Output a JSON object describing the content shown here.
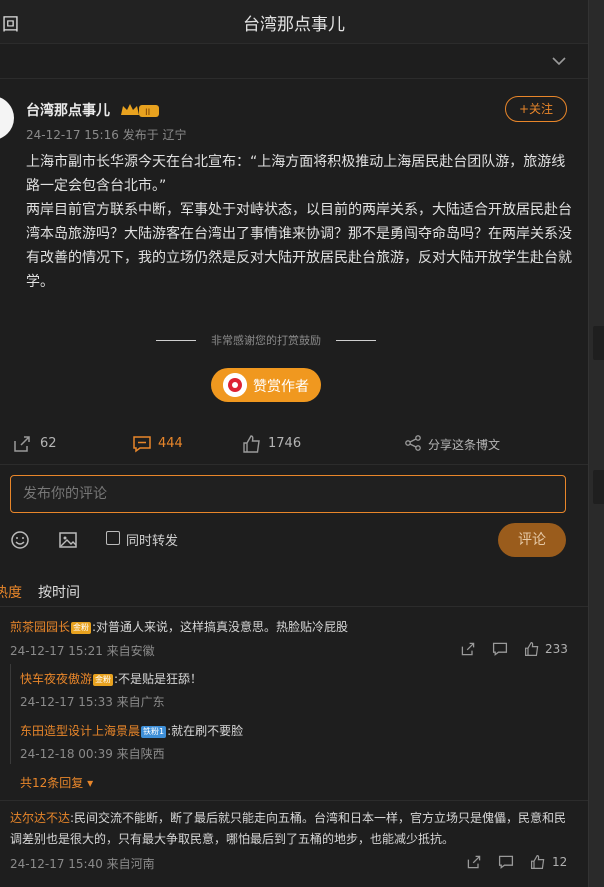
{
  "header": {
    "back_label": "回",
    "title": "台湾那点事儿"
  },
  "post": {
    "author": "台湾那点事儿",
    "vip_badge": "II",
    "time": "24-12-17 15:16",
    "source": "发布于 辽宁",
    "follow_label": "+关注",
    "paragraphs": [
      "上海市副市长华源今天在台北宣布：“上海方面将积极推动上海居民赴台团队游，旅游线路一定会包含台北市。”",
      "两岸目前官方联系中断，军事处于对峙状态，以目前的两岸关系，大陆适合开放居民赴台湾本岛旅游吗？大陆游客在台湾出了事情谁来协调？那不是勇闯夺命岛吗？在两岸关系没有改善的情况下，我的立场仍然是反对大陆开放居民赴台旅游，反对大陆开放学生赴台就学。"
    ],
    "thanks_text": "非常感谢您的打赏鼓励",
    "reward_label": "赞赏作者",
    "repost_count": "62",
    "comment_count": "444",
    "like_count": "1746",
    "share_label": "分享这条博文"
  },
  "comment_form": {
    "placeholder": "发布你的评论",
    "repost_label": "同时转发",
    "submit_label": "评论"
  },
  "tabs": {
    "hot": "热度",
    "time": "按时间"
  },
  "comments": [
    {
      "user": "煎茶园园长",
      "badge": "金粉",
      "text": ":对普通人来说，这样搞真没意思。热脸贴冷屁股",
      "time": "24-12-17 15:21 来自安徽",
      "likes": "233",
      "replies": [
        {
          "user": "快车夜夜傲游",
          "badge": "金粉",
          "text": ":不是贴是狂舔！",
          "time": "24-12-17 15:33 来自广东"
        },
        {
          "user": "东田造型设计上海景晨",
          "badge": "铁粉1",
          "text": ":就在刷不要脸",
          "time": "24-12-18 00:39 来自陕西"
        }
      ],
      "more_label": "共12条回复"
    },
    {
      "user": "达尔达不达",
      "text": ":民间交流不能断，断了最后就只能走向五桶。台湾和日本一样，官方立场只是傀儡，民意和民调差别也是很大的，只有最大争取民意，哪怕最后到了五桶的地步，也能减少抵抗。",
      "time": "24-12-17 15:40 来自河南",
      "likes": "12"
    }
  ],
  "colors": {
    "accent": "#e8862a",
    "background": "#1e1e1e"
  }
}
